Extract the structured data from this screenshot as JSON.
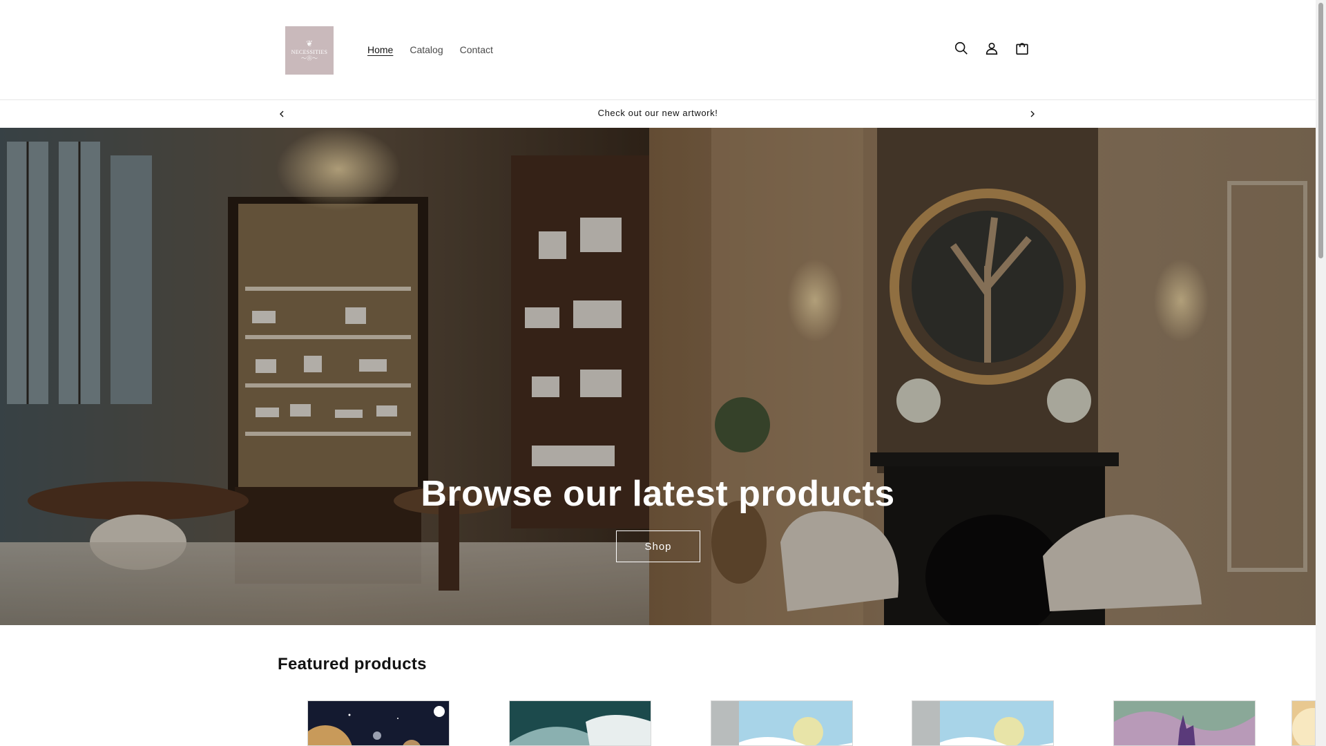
{
  "brand": {
    "logo_text": "NECESSITIES",
    "logo_bg": "#c9b9bb"
  },
  "nav": {
    "items": [
      {
        "label": "Home",
        "active": true
      },
      {
        "label": "Catalog",
        "active": false
      },
      {
        "label": "Contact",
        "active": false
      }
    ]
  },
  "header_icons": [
    "search-icon",
    "account-icon",
    "cart-icon"
  ],
  "announcement": {
    "text": "Check out our new artwork!"
  },
  "hero": {
    "title": "Browse our latest products",
    "button_label": "Shop"
  },
  "featured": {
    "title": "Featured products"
  },
  "colors": {
    "text": "#121212",
    "muted": "#4a4a4a",
    "background": "#ffffff"
  }
}
